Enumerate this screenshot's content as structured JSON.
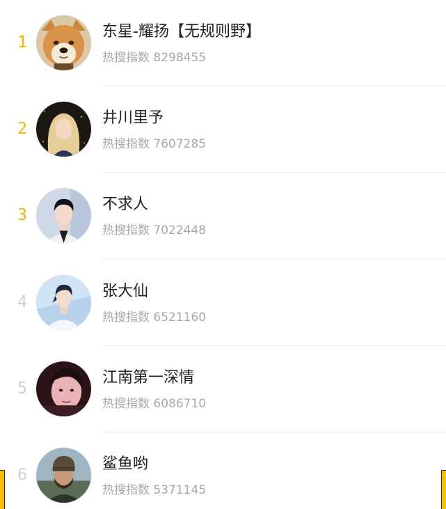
{
  "colors": {
    "top_rank": "#f2b500",
    "rank": "#cfcfcf",
    "name": "#222222",
    "index": "#a8a8a8",
    "accent": "#f4c200"
  },
  "items": [
    {
      "rank": "1",
      "name": "东星-耀扬【无规则野】",
      "index": "热搜指数 8298455",
      "avatar_icon": "shiba-dog-avatar-icon"
    },
    {
      "rank": "2",
      "name": "井川里予",
      "index": "热搜指数 7607285",
      "avatar_icon": "blonde-girl-avatar-icon"
    },
    {
      "rank": "3",
      "name": "不求人",
      "index": "热搜指数 7022448",
      "avatar_icon": "young-man-avatar-icon"
    },
    {
      "rank": "4",
      "name": "张大仙",
      "index": "热搜指数 6521160",
      "avatar_icon": "man-white-jacket-avatar-icon"
    },
    {
      "rank": "5",
      "name": "江南第一深情",
      "index": "热搜指数 6086710",
      "avatar_icon": "man-pink-light-avatar-icon"
    },
    {
      "rank": "6",
      "name": "鲨鱼哟",
      "index": "热搜指数 5371145",
      "avatar_icon": "bearded-man-beanie-avatar-icon"
    }
  ]
}
